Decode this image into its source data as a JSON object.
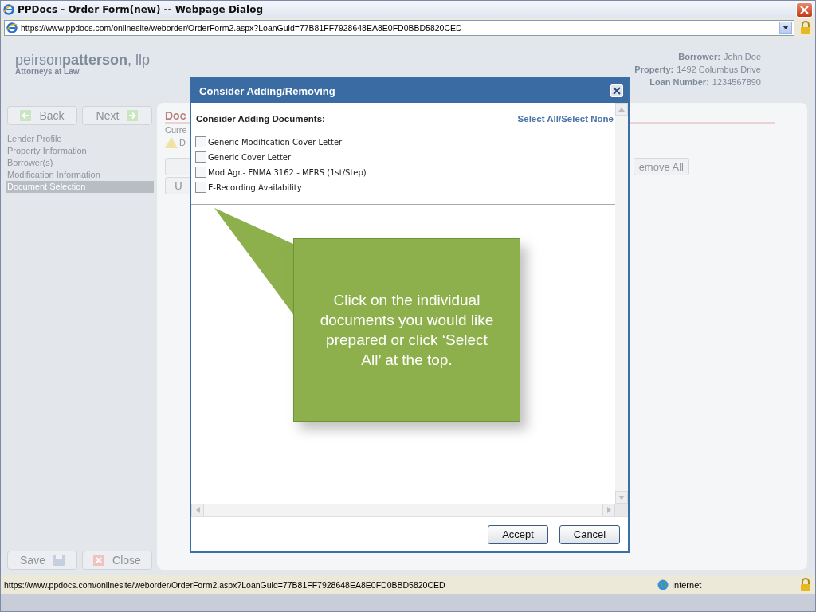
{
  "window": {
    "title": "PPDocs - Order Form(new) -- Webpage Dialog"
  },
  "address_bar": {
    "url": "https://www.ppdocs.com/onlinesite/weborder/OrderForm2.aspx?LoanGuid=77B81FF7928648EA8E0FD0BBD5820CED"
  },
  "header": {
    "logo": "peirson**patterson**, llp",
    "tagline": "Attorneys at Law",
    "info": [
      {
        "label": "Borrower:",
        "value": "John Doe"
      },
      {
        "label": "Property:",
        "value": "1492 Columbus Drive"
      },
      {
        "label": "Loan Number:",
        "value": "1234567890"
      }
    ]
  },
  "nav": {
    "back": "Back",
    "next": "Next",
    "items": [
      {
        "label": "Lender Profile",
        "selected": false
      },
      {
        "label": "Property Information",
        "selected": false
      },
      {
        "label": "Borrower(s)",
        "selected": false
      },
      {
        "label": "Modification Information",
        "selected": false
      },
      {
        "label": "Document Selection",
        "selected": true
      }
    ],
    "save": "Save",
    "close": "Close"
  },
  "main": {
    "heading": "Doc",
    "subheading": "Curre",
    "warning": "D",
    "button_2": "U",
    "remove_all": "emove All"
  },
  "dialog": {
    "title": "Consider Adding/Removing",
    "section": "Consider Adding Documents:",
    "select_all": "Select All",
    "separator": "/",
    "select_none": "Select None",
    "documents": [
      {
        "label": "Generic Modification Cover Letter",
        "checked": false
      },
      {
        "label": "Generic Cover Letter",
        "checked": false
      },
      {
        "label": "Mod Agr.- FNMA 3162 - MERS (1st/Step)",
        "checked": false
      },
      {
        "label": "E-Recording Availability",
        "checked": false
      }
    ],
    "buttons": [
      "Accept",
      "Cancel"
    ]
  },
  "callout": {
    "text": "Click on the individual documents you would like prepared or click ‘Select All’ at the top."
  },
  "status_bar": {
    "url": "https://www.ppdocs.com/onlinesite/weborder/OrderForm2.aspx?LoanGuid=77B81FF7928648EA8E0FD0BBD5820CED",
    "zone": "Internet"
  }
}
